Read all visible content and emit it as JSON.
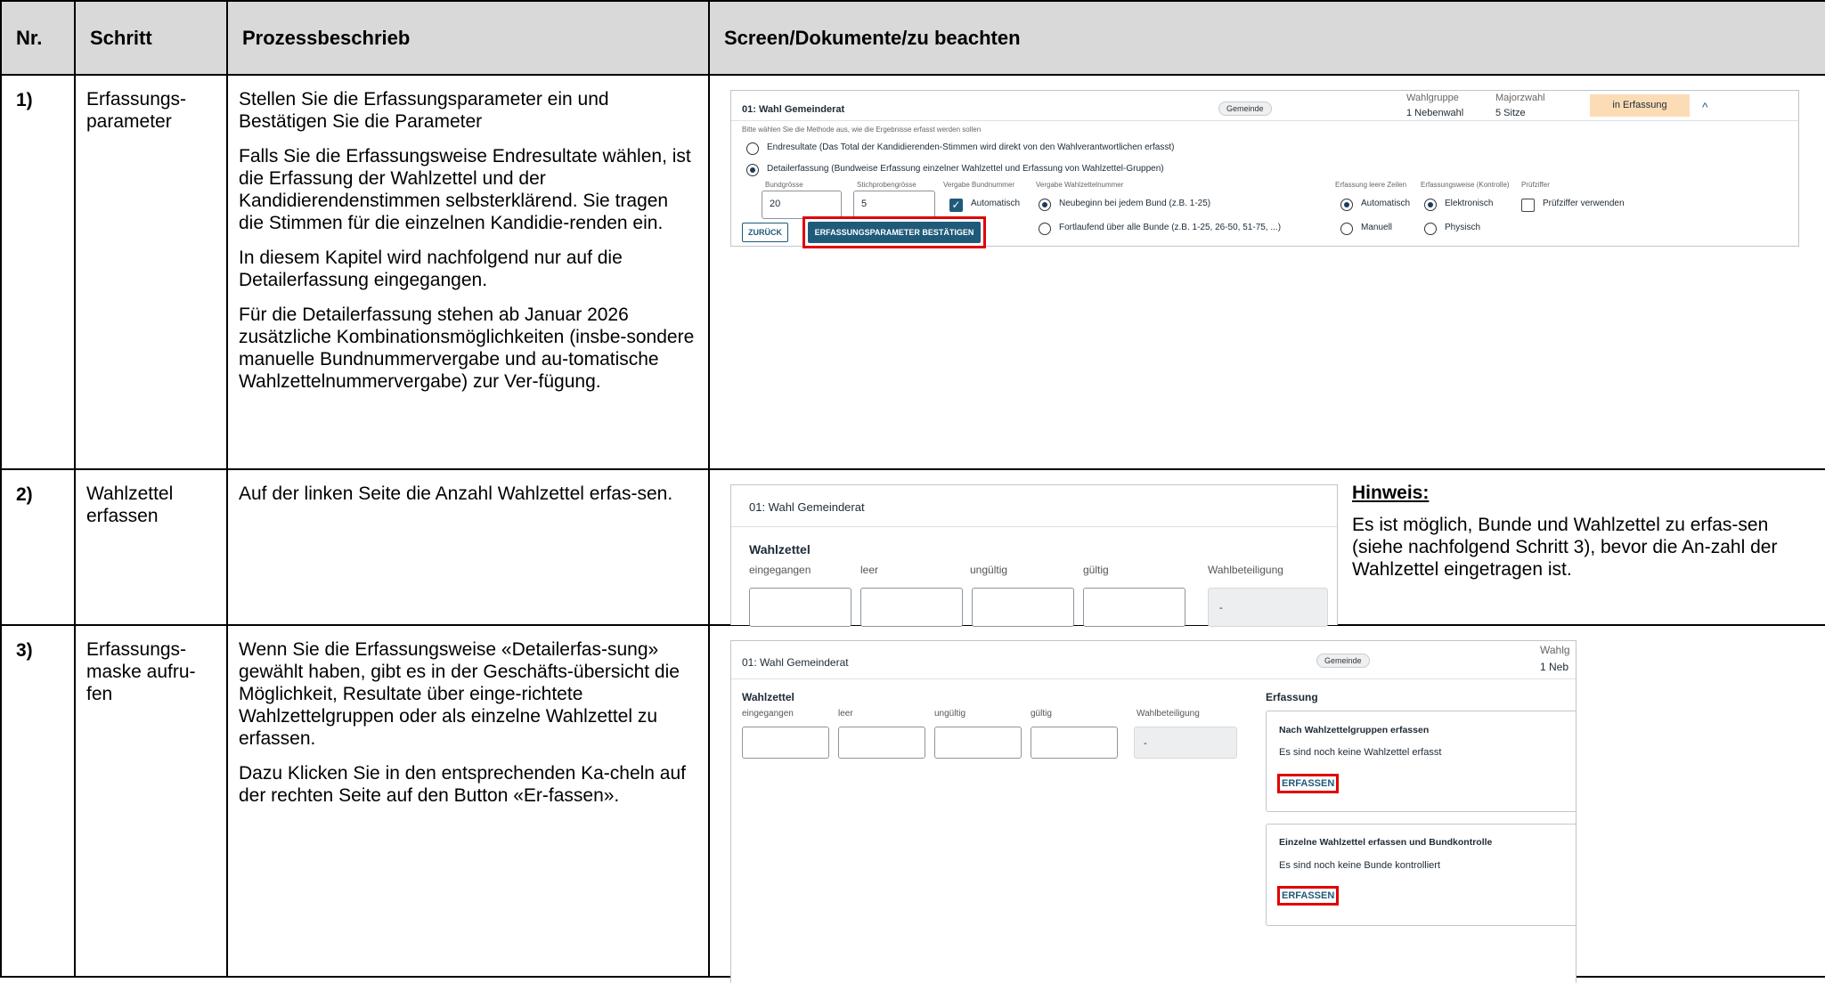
{
  "headers": [
    "Nr.",
    "Schritt",
    "Prozessbeschrieb",
    "Screen/Dokumente/zu beachten"
  ],
  "rows": [
    {
      "nr": "1)",
      "step": [
        "Erfassungs-",
        "parameter"
      ],
      "desc": [
        "Stellen Sie die Erfassungsparameter ein und Bestätigen Sie die Parameter",
        "Falls Sie die Erfassungsweise Endresultate wählen, ist die Erfassung der Wahlzettel und der Kandidierendenstimmen selbsterklärend. Sie tragen die Stimmen für die einzelnen Kandidie-renden ein.",
        "In diesem Kapitel wird nachfolgend nur auf die Detailerfassung eingegangen.",
        "Für die Detailerfassung stehen ab Januar 2026 zusätzliche Kombinationsmöglichkeiten (insbe-sondere manuelle Bundnummervergabe und au-tomatische Wahlzettelnummervergabe) zur Ver-fügung."
      ]
    },
    {
      "nr": "2)",
      "step": [
        "Wahlzettel",
        "erfassen"
      ],
      "desc": [
        "Auf der linken Seite die Anzahl Wahlzettel erfas-sen."
      ],
      "note_title": "Hinweis:",
      "note_text": "Es ist möglich, Bunde und Wahlzettel zu erfas-sen (siehe nachfolgend Schritt 3), bevor die An-zahl der Wahlzettel eingetragen ist."
    },
    {
      "nr": "3)",
      "step": [
        "Erfassungs-",
        "maske aufru-",
        "fen"
      ],
      "desc": [
        "Wenn Sie die Erfassungsweise «Detailerfas-sung» gewählt haben, gibt es in der Geschäfts-übersicht die Möglichkeit, Resultate über einge-richtete Wahlzettelgruppen oder als einzelne Wahlzettel zu erfassen.",
        "Dazu Klicken Sie in den entsprechenden Ka-cheln auf der rechten Seite auf den Button «Er-fassen»."
      ]
    }
  ],
  "s1": {
    "title": "01: Wahl Gemeinderat",
    "badge": "Gemeinde",
    "col1_label": "Wahlgruppe",
    "col1_value": "1 Nebenwahl",
    "col2_label": "Majorzwahl",
    "col2_value": "5 Sitze",
    "status": "in Erfassung",
    "chevron": "^",
    "hint": "Bitte wählen Sie die Methode aus, wie die Ergebnisse erfasst werden sollen",
    "opt_endresultate": "Endresultate (Das Total der Kandidierenden-Stimmen wird direkt von den Wahlverantwortlichen erfasst)",
    "opt_detail": "Detailerfassung (Bundweise Erfassung einzelner Wahlzettel und Erfassung von Wahlzettel-Gruppen)",
    "lbl_bundgroesse": "Bundgrösse",
    "val_bundgroesse": "20",
    "lbl_stichprobe": "Stichprobengrösse",
    "val_stichprobe": "5",
    "lbl_vergabe_bund": "Vergabe Bundnummer",
    "chk_automatisch": "Automatisch",
    "check_mark": "✓",
    "lbl_vergabe_wz": "Vergabe Wahlzettelnummer",
    "opt_neubeginn": "Neubeginn bei jedem Bund (z.B. 1-25)",
    "opt_fortlaufend": "Fortlaufend über alle Bunde (z.B. 1-25, 26-50, 51-75, ...)",
    "lbl_leere": "Erfassung leere Zeilen",
    "opt_auto": "Automatisch",
    "opt_manuell": "Manuell",
    "lbl_weise": "Erfassungsweise (Kontrolle)",
    "opt_elektronisch": "Elektronisch",
    "opt_physisch": "Physisch",
    "lbl_pruef": "Prüfziffer",
    "chk_pruef": "Prüfziffer verwenden",
    "btn_back": "ZURÜCK",
    "btn_confirm": "ERFASSUNGSPARAMETER BESTÄTIGEN"
  },
  "s2": {
    "title": "01: Wahl Gemeinderat",
    "section": "Wahlzettel",
    "cols": [
      "eingegangen",
      "leer",
      "ungültig",
      "gültig",
      "Wahlbeteiligung"
    ],
    "dash": "-"
  },
  "s3": {
    "title": "01: Wahl Gemeinderat",
    "badge": "Gemeinde",
    "top_right_1": "Wahlg",
    "top_right_2": "1 Neb",
    "section": "Wahlzettel",
    "cols": [
      "eingegangen",
      "leer",
      "ungültig",
      "gültig",
      "Wahlbeteiligung"
    ],
    "dash": "-",
    "erfassung": "Erfassung",
    "card1_title": "Nach Wahlzettelgruppen erfassen",
    "card1_text": "Es sind noch keine Wahlzettel erfasst",
    "card1_btn": "ERFASSEN",
    "card2_title": "Einzelne Wahlzettel erfassen und Bundkontrolle",
    "card2_text": "Es sind noch keine Bunde kontrolliert",
    "card2_btn": "ERFASSEN"
  }
}
